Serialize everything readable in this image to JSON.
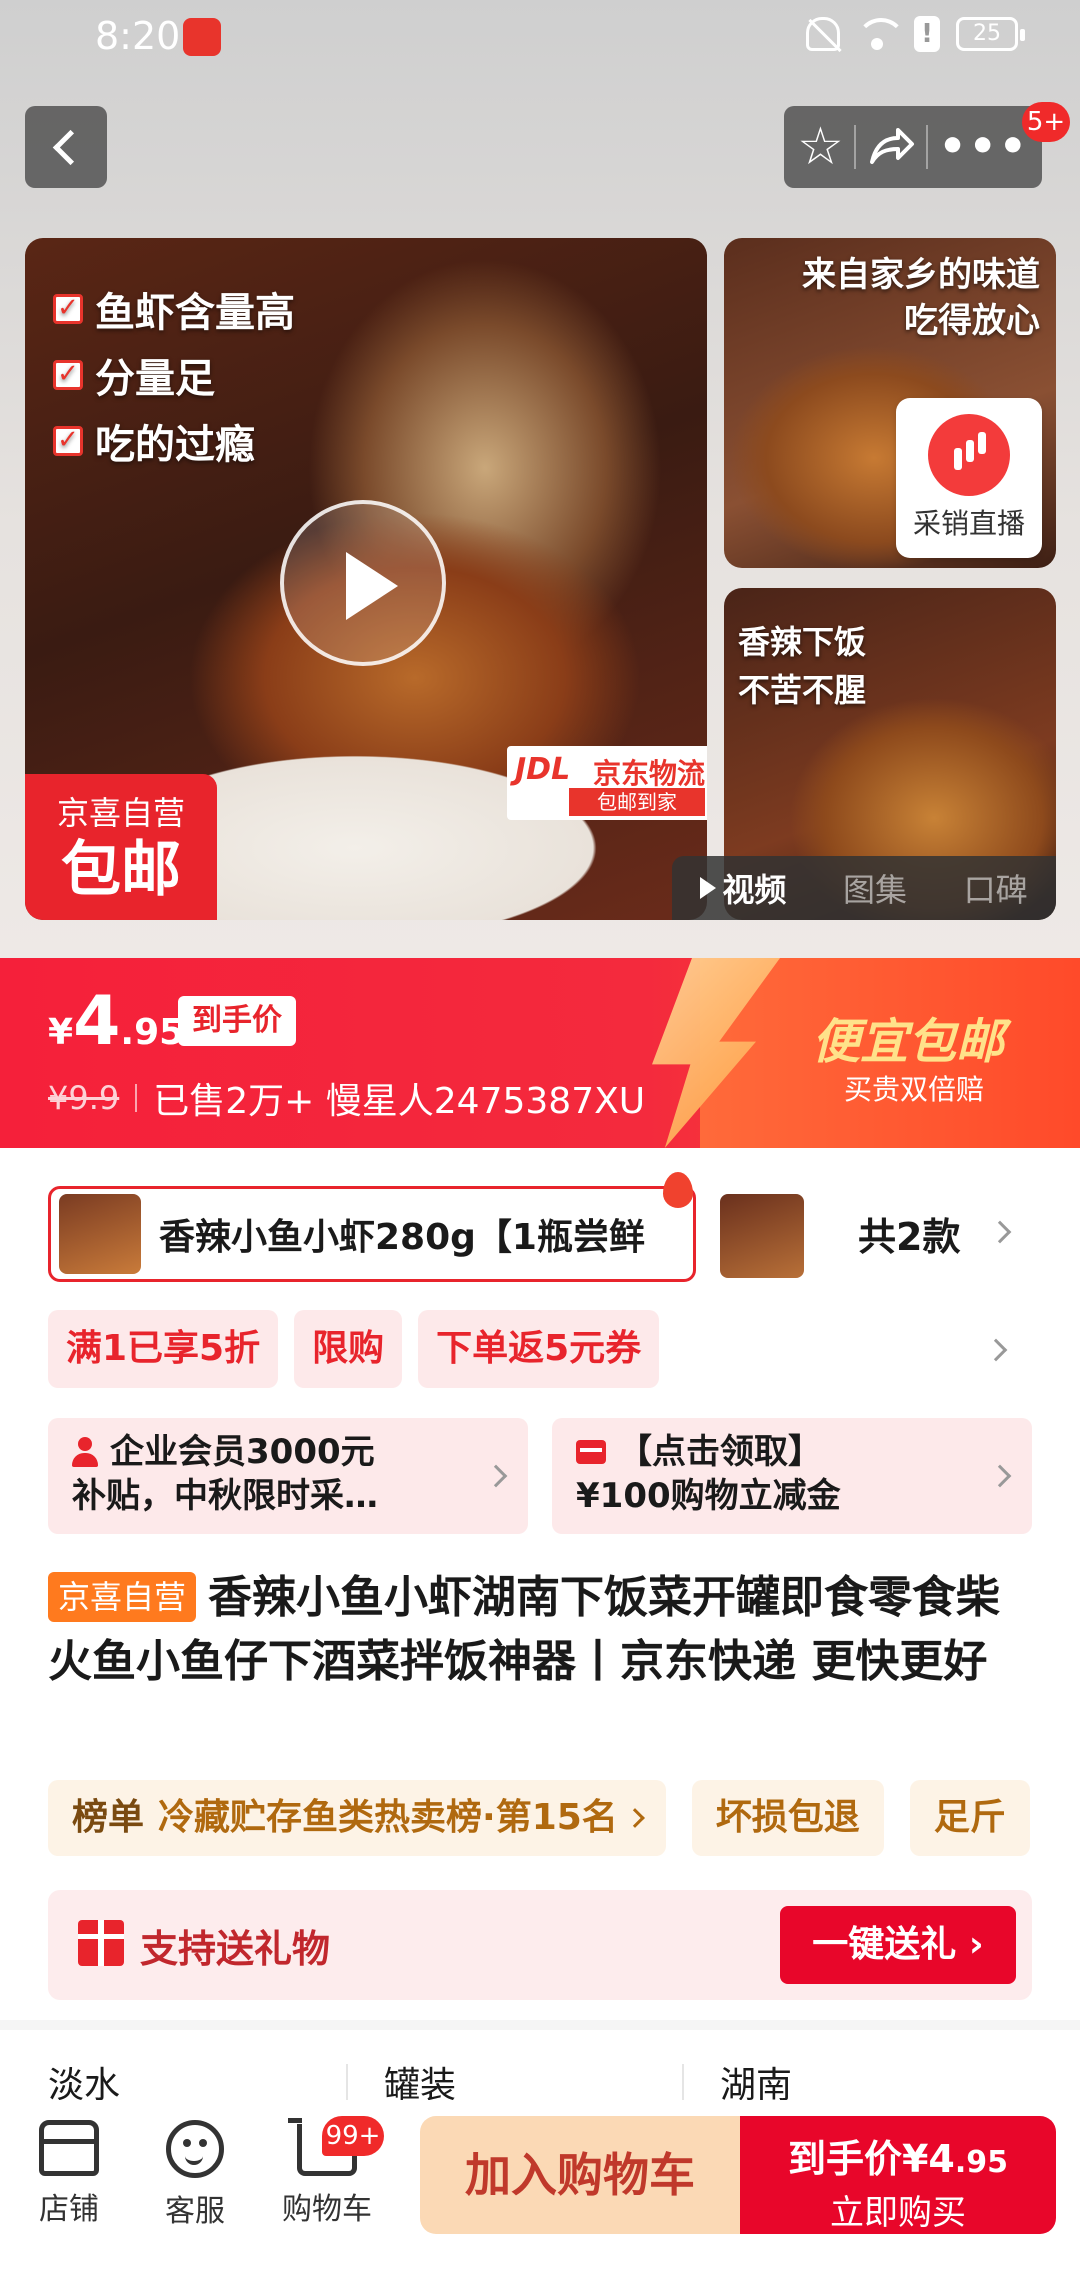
{
  "status_bar": {
    "time": "8:20",
    "battery": "25"
  },
  "header": {
    "more_badge": "5+"
  },
  "gallery": {
    "main_features": [
      "鱼虾含量高",
      "分量足",
      "吃的过瘾"
    ],
    "self_badge_line1": "京喜自营",
    "self_badge_line2": "包邮",
    "jdl_logo": "JDL",
    "jdl_text": "京东物流",
    "jdl_sub": "包邮到家",
    "thumb1_title_line1": "来自家乡的味道",
    "thumb1_title_line2": "吃得放心",
    "live_label": "采销直播",
    "thumb2_title_line1": "香辣下饭",
    "thumb2_title_line2": "不苦不腥",
    "media_tabs": [
      "视频",
      "图集",
      "口碑"
    ]
  },
  "price": {
    "currency": "¥",
    "integer": "4",
    "decimal": ".95",
    "tag": "到手价",
    "original": "¥9.9",
    "sold_info": "已售2万+ 慢星人2475387XU",
    "promo_title": "便宜包邮",
    "promo_sub": "买贵双倍赔"
  },
  "variants": {
    "selected_label": "香辣小鱼小虾280g【1瓶尝鲜",
    "count": "共2款"
  },
  "promos": [
    "满1已享5折",
    "限购",
    "下单返5元券"
  ],
  "coupons": [
    {
      "line1": "企业会员3000元",
      "line2": "补贴，中秋限时采…"
    },
    {
      "line1": "【点击领取】",
      "line2": "¥100购物立减金"
    }
  ],
  "product": {
    "badge": "京喜自营",
    "title": "香辣小鱼小虾湖南下饭菜开罐即食零食柴火鱼小鱼仔下酒菜拌饭神器丨京东快递 更快更好"
  },
  "rank": {
    "label": "榜单",
    "text": "冷藏贮存鱼类热卖榜·第15名",
    "chip2": "坏损包退",
    "chip3": "足斤"
  },
  "gift": {
    "label": "支持送礼物",
    "button": "一键送礼"
  },
  "attributes": [
    "淡水",
    "罐装",
    "湖南"
  ],
  "bottom_bar": {
    "store": "店铺",
    "service": "客服",
    "cart": "购物车",
    "cart_badge": "99+",
    "add_to_cart": "加入购物车",
    "buy_prefix": "到手价",
    "buy_price_int": "¥4",
    "buy_price_dec": ".95",
    "buy_now": "立即购买"
  }
}
